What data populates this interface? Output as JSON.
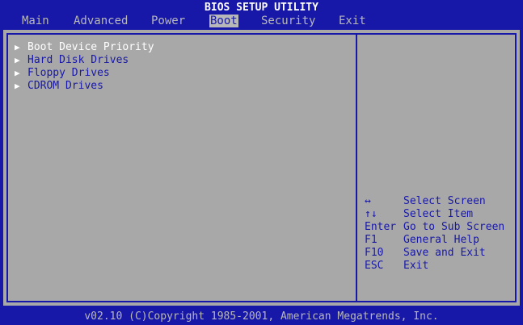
{
  "title": "BIOS SETUP UTILITY",
  "menu": [
    {
      "label": "Main",
      "active": false
    },
    {
      "label": "Advanced",
      "active": false
    },
    {
      "label": "Power",
      "active": false
    },
    {
      "label": "Boot",
      "active": true
    },
    {
      "label": "Security",
      "active": false
    },
    {
      "label": "Exit",
      "active": false
    }
  ],
  "boot_items": [
    {
      "label": "Boot Device Priority",
      "selected": true
    },
    {
      "label": "Hard Disk Drives",
      "selected": false
    },
    {
      "label": "Floppy Drives",
      "selected": false
    },
    {
      "label": "CDROM Drives",
      "selected": false
    }
  ],
  "help": [
    {
      "key": "↔",
      "action": "Select Screen"
    },
    {
      "key": "↑↓",
      "action": "Select Item"
    },
    {
      "key": "Enter",
      "action": "Go to Sub Screen"
    },
    {
      "key": "F1",
      "action": "General Help"
    },
    {
      "key": "F10",
      "action": "Save and Exit"
    },
    {
      "key": "ESC",
      "action": "Exit"
    }
  ],
  "footer": "v02.10 (C)Copyright 1985-2001, American Megatrends, Inc.",
  "colors": {
    "background": "#1818a8",
    "panel": "#a8a8a8",
    "highlight_text": "#ffffff",
    "menu_text": "#b8b8b8"
  }
}
